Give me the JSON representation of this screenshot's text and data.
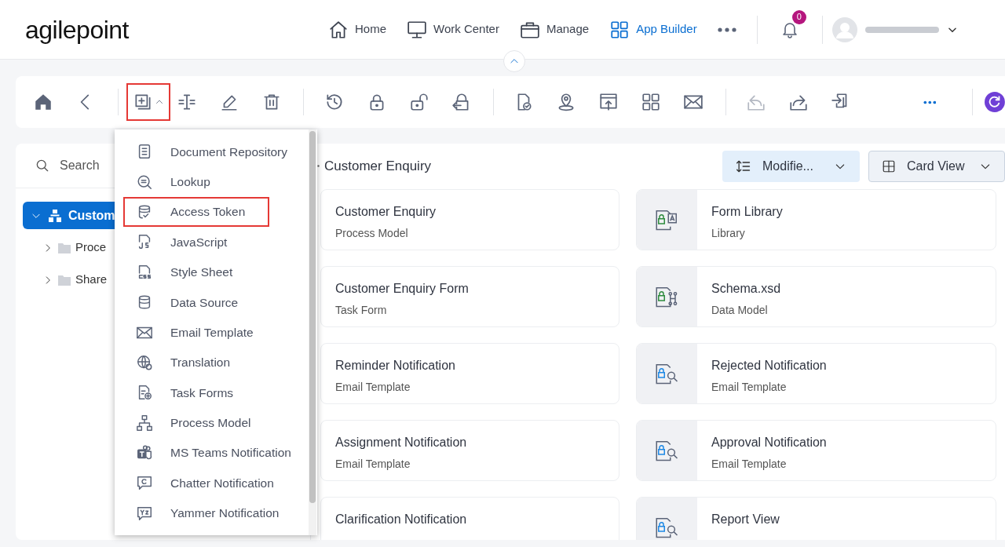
{
  "header": {
    "logo": "agilepoint",
    "nav": [
      {
        "label": "Home",
        "selected": false
      },
      {
        "label": "Work Center",
        "selected": false
      },
      {
        "label": "Manage",
        "selected": false
      },
      {
        "label": "App Builder",
        "selected": true
      }
    ],
    "notifications": "0"
  },
  "toolbar": {
    "groups": [
      [
        {
          "highlighted": false,
          "disabled": false
        },
        {
          "highlighted": false,
          "disabled": false
        }
      ],
      [
        {
          "highlighted": true,
          "disabled": false
        },
        {
          "highlighted": false,
          "disabled": false
        },
        {
          "highlighted": false,
          "disabled": false
        },
        {
          "highlighted": false,
          "disabled": false
        }
      ],
      [
        {
          "highlighted": false,
          "disabled": false
        },
        {
          "highlighted": false,
          "disabled": false
        },
        {
          "highlighted": false,
          "disabled": false
        },
        {
          "highlighted": false,
          "disabled": false
        }
      ],
      [
        {
          "highlighted": false,
          "disabled": false
        },
        {
          "highlighted": false,
          "disabled": false
        },
        {
          "highlighted": false,
          "disabled": false
        },
        {
          "highlighted": false,
          "disabled": false
        },
        {
          "highlighted": false,
          "disabled": false
        }
      ],
      [
        {
          "highlighted": false,
          "disabled": true
        },
        {
          "highlighted": false,
          "disabled": false
        },
        {
          "highlighted": false,
          "disabled": false
        }
      ]
    ]
  },
  "sidebar": {
    "search": {
      "placeholder": "Search"
    },
    "tree": [
      {
        "label": "Custom",
        "selected": true,
        "expanded": true,
        "children": [
          {
            "label": "Proce",
            "selected": false,
            "expanded": false
          },
          {
            "label": "Share",
            "selected": false,
            "expanded": false
          }
        ]
      }
    ]
  },
  "breadcrumb": "Customer Enquiry",
  "sort": {
    "label": "Modifie..."
  },
  "view": {
    "label": "Card View"
  },
  "cards": [
    {
      "title": "Customer Enquiry",
      "subtitle": "Process Model",
      "kind": "plain"
    },
    {
      "title": "Form Library",
      "subtitle": "Library",
      "kind": "tile"
    },
    {
      "title": "Customer Enquiry Form",
      "subtitle": "Task Form",
      "kind": "plain"
    },
    {
      "title": "Schema.xsd",
      "subtitle": "Data Model",
      "kind": "tile"
    },
    {
      "title": "Reminder Notification",
      "subtitle": "Email Template",
      "kind": "plain"
    },
    {
      "title": "Rejected Notification",
      "subtitle": "Email Template",
      "kind": "tile"
    },
    {
      "title": "Assignment Notification",
      "subtitle": "Email Template",
      "kind": "plain"
    },
    {
      "title": "Approval Notification",
      "subtitle": "Email Template",
      "kind": "tile"
    },
    {
      "title": "Clarification Notification",
      "kind": "plain"
    },
    {
      "title": "Report View",
      "kind": "tile"
    }
  ],
  "menu": [
    {
      "label": "Document Repository",
      "highlighted": false
    },
    {
      "label": "Lookup",
      "highlighted": false
    },
    {
      "label": "Access Token",
      "highlighted": true
    },
    {
      "label": "JavaScript",
      "highlighted": false
    },
    {
      "label": "Style Sheet",
      "highlighted": false
    },
    {
      "label": "Data Source",
      "highlighted": false
    },
    {
      "label": "Email Template",
      "highlighted": false
    },
    {
      "label": "Translation",
      "highlighted": false
    },
    {
      "label": "Task Forms",
      "highlighted": false
    },
    {
      "label": "Process Model",
      "highlighted": false
    },
    {
      "label": "MS Teams Notification",
      "highlighted": false
    },
    {
      "label": "Chatter Notification",
      "highlighted": false
    },
    {
      "label": "Yammer Notification",
      "highlighted": false
    }
  ]
}
